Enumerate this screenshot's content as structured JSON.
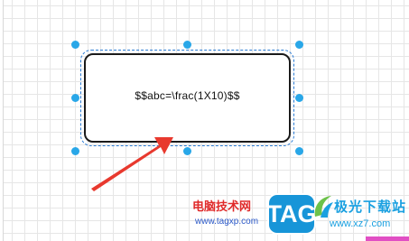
{
  "canvas": {
    "shape_text": "$$abc=\\frac(1X10)$$"
  },
  "watermark": {
    "cn_label": "电脑技术网",
    "url": "www.tagxp.com",
    "logo_text": "TAG",
    "site_name": "极光下载站",
    "site_url": "www.xz7.com"
  },
  "colors": {
    "handle": "#29a7e8",
    "arrow": "#e8392e",
    "selection_outline": "#2a7bd4"
  }
}
